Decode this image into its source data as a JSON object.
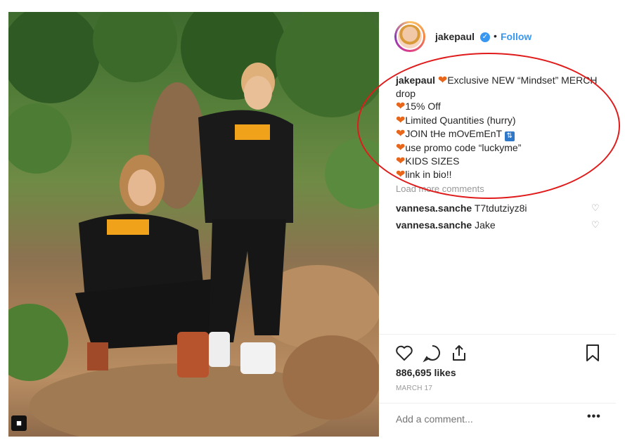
{
  "header": {
    "username": "jakepaul",
    "separator": "•",
    "follow_label": "Follow"
  },
  "caption": {
    "username": "jakepaul",
    "lines": [
      "Exclusive NEW “Mindset” MERCH drop",
      "15% Off",
      "Limited Quantities (hurry)",
      "JOIN tHe mOvEmEnT",
      "use promo code “luckyme”",
      "KIDS SIZES",
      "link in bio!!"
    ]
  },
  "load_more_label": "Load more comments",
  "comments": [
    {
      "user": "vannesa.sanche",
      "text": "T7tdutziyz8i"
    },
    {
      "user": "vannesa.sanche",
      "text": "Jake"
    }
  ],
  "likes": "886,695 likes",
  "date": "MARCH 17",
  "add_comment_placeholder": "Add a comment...",
  "more_label": "•••",
  "colors": {
    "follow": "#3897f0",
    "annotation_oval": "#e01b1b",
    "heart_emoji": "#e8661b"
  },
  "icons": [
    "heart-icon",
    "comment-icon",
    "share-icon",
    "bookmark-icon",
    "verified-badge-icon",
    "user-tag-icon"
  ]
}
